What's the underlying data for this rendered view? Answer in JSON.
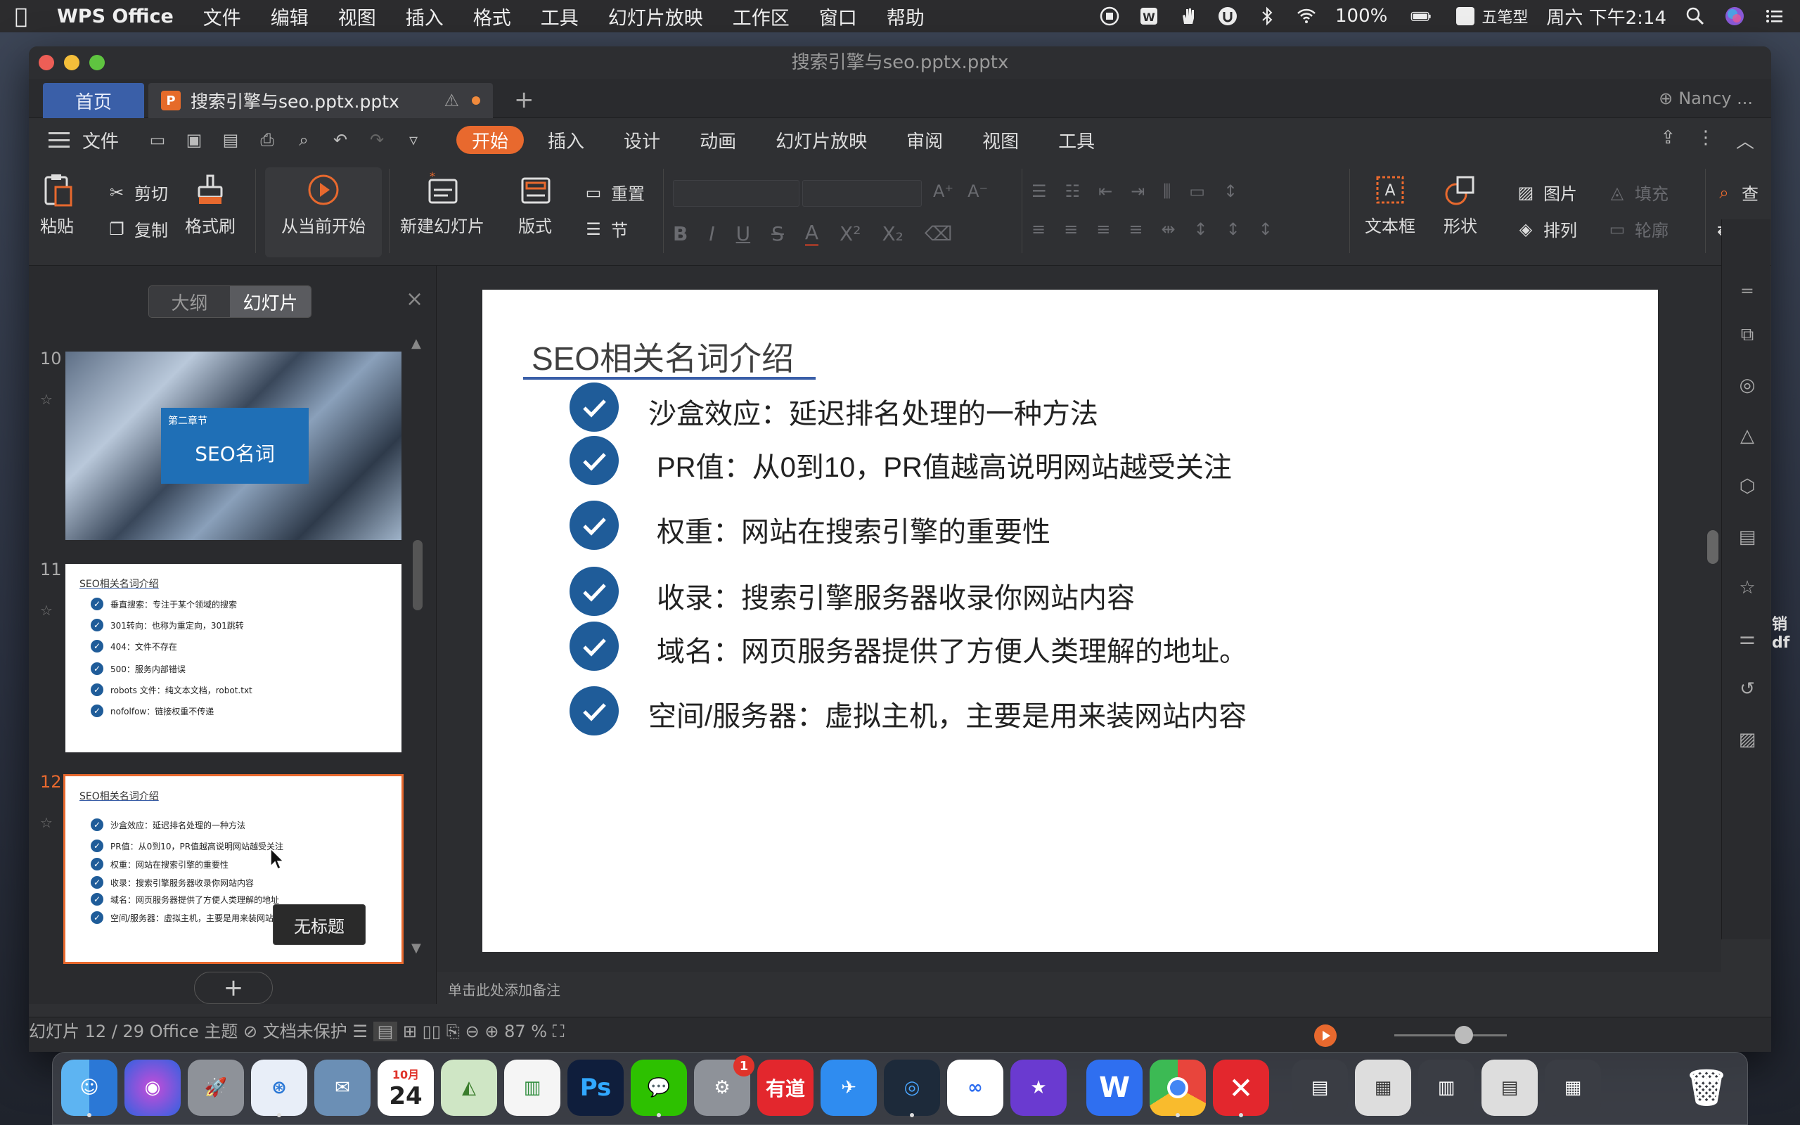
{
  "menubar": {
    "app": "WPS Office",
    "items": [
      "文件",
      "编辑",
      "视图",
      "插入",
      "格式",
      "工具",
      "幻灯片放映",
      "工作区",
      "窗口",
      "帮助"
    ],
    "battery": "100%",
    "input_method": "五笔型",
    "input_icon": "型",
    "clock": "周六 下午2:14"
  },
  "window": {
    "title": "搜索引擎与seo.pptx.pptx",
    "home_tab": "首页",
    "doc_tab": "搜索引擎与seo.pptx.pptx",
    "doc_icon_letter": "P",
    "user": "Nancy ..."
  },
  "menurow": {
    "file": "文件",
    "tabs": [
      "开始",
      "插入",
      "设计",
      "动画",
      "幻灯片放映",
      "审阅",
      "视图",
      "工具"
    ]
  },
  "ribbon": {
    "paste": "粘贴",
    "cut": "剪切",
    "copy": "复制",
    "format_painter": "格式刷",
    "play_from_current": "从当前开始",
    "new_slide": "新建幻灯片",
    "layout": "版式",
    "reset": "重置",
    "section": "节",
    "textbox": "文本框",
    "shape": "形状",
    "picture": "图片",
    "arrange": "排列",
    "fill": "填充",
    "outline": "轮廓",
    "find": "查",
    "replace": "替"
  },
  "leftpanel": {
    "outline_tab": "大纲",
    "slides_tab": "幻灯片",
    "tooltip": "无标题",
    "thumbs": [
      {
        "num": "10",
        "chapter": "第二章节",
        "title": "SEO名词"
      },
      {
        "num": "11",
        "title": "SEO相关名词介绍",
        "items": [
          "垂直搜索：专注于某个领域的搜索",
          "301转向：也称为重定向，301跳转",
          "404：文件不存在",
          "500：服务内部错误",
          "robots 文件：纯文本文档，robot.txt",
          "nofolfow：链接权重不传递"
        ]
      },
      {
        "num": "12",
        "title": "SEO相关名词介绍",
        "items": [
          "沙盒效应：延迟排名处理的一种方法",
          "PR值：从0到10，PR值越高说明网站越受关注",
          "权重：网站在搜索引擎的重要性",
          "收录：搜索引擎服务器收录你网站内容",
          "域名：网页服务器提供了方便人类理解的地址",
          "空间/服务器：虚拟主机，主要是用来装网站"
        ]
      }
    ]
  },
  "slide": {
    "title": "SEO相关名词介绍",
    "items": [
      "沙盒效应：延迟排名处理的一种方法",
      "PR值：从0到10，PR值越高说明网站越受关注",
      "权重：网站在搜索引擎的重要性",
      "收录：搜索引擎服务器收录你网站内容",
      "域名：网页服务器提供了方便人类理解的地址。",
      "空间/服务器：虚拟主机，主要是用来装网站内容"
    ],
    "notes_placeholder": "单击此处添加备注"
  },
  "side_panel_clip": [
    "销",
    "df"
  ],
  "status": {
    "slide_counter": "幻灯片 12 / 29",
    "theme": "Office 主题",
    "protection": "文档未保护",
    "zoom": "87 %",
    "zoom_fraction": 0.62
  },
  "dock": {
    "calendar_month": "10月",
    "calendar_day": "24",
    "settings_badge": "1",
    "youdao": "有道",
    "ps": "Ps",
    "wps": "W"
  },
  "colors": {
    "accent": "#e8692e",
    "slide_blue": "#1f5c99",
    "home_tab": "#3a5fa8"
  }
}
